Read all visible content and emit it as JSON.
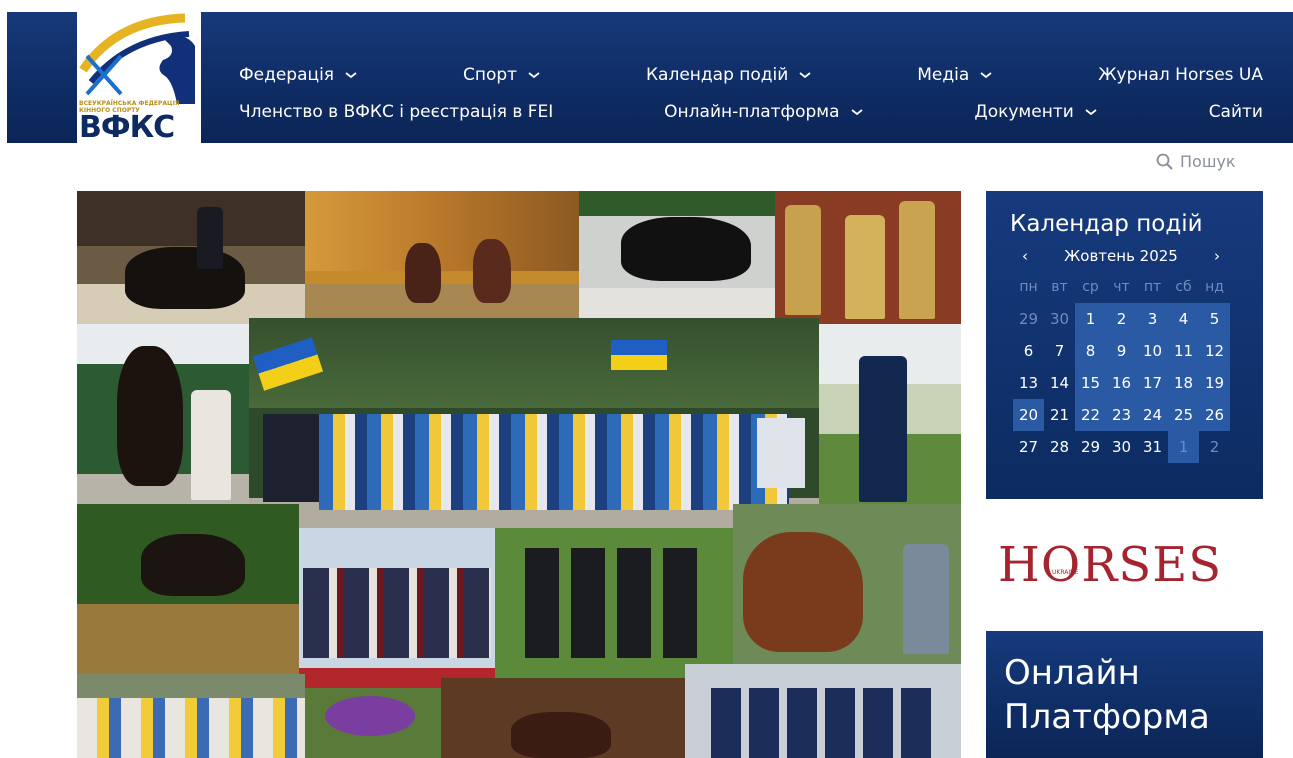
{
  "header": {
    "logo": {
      "alt_text_small": "ВСЕУКРАЇНСЬКА ФЕДЕРАЦІЯ КІННОГО СПОРТУ",
      "abbr": "ВФКС"
    },
    "nav_row_1": [
      {
        "label": "Федерація",
        "dropdown": true
      },
      {
        "label": "Спорт",
        "dropdown": true
      },
      {
        "label": "Календар подій",
        "dropdown": true
      },
      {
        "label": "Медіа",
        "dropdown": true
      },
      {
        "label": "Журнал Horses UA",
        "dropdown": false
      }
    ],
    "nav_row_2": [
      {
        "label": "Членство в ВФКС і реєстрація в FEI",
        "dropdown": false
      },
      {
        "label": "Онлайн-платформа",
        "dropdown": true
      },
      {
        "label": "Документи",
        "dropdown": true
      },
      {
        "label": "Сайти",
        "dropdown": false
      }
    ]
  },
  "search": {
    "label": "Пошук",
    "icon": "search-icon"
  },
  "calendar": {
    "title": "Календар подій",
    "month_label": "Жовтень 2025",
    "prev": "‹",
    "next": "›",
    "weekdays": [
      "пн",
      "вт",
      "ср",
      "чт",
      "пт",
      "сб",
      "нд"
    ],
    "weeks": [
      [
        {
          "d": "29",
          "other": true
        },
        {
          "d": "30",
          "other": true
        },
        {
          "d": "1",
          "hl": true
        },
        {
          "d": "2",
          "hl": true
        },
        {
          "d": "3",
          "hl": true
        },
        {
          "d": "4",
          "hl": true
        },
        {
          "d": "5",
          "hl": true
        }
      ],
      [
        {
          "d": "6"
        },
        {
          "d": "7"
        },
        {
          "d": "8",
          "hl": true
        },
        {
          "d": "9",
          "hl": true
        },
        {
          "d": "10",
          "hl": true
        },
        {
          "d": "11",
          "hl": true
        },
        {
          "d": "12",
          "hl": true
        }
      ],
      [
        {
          "d": "13"
        },
        {
          "d": "14"
        },
        {
          "d": "15",
          "hl": true
        },
        {
          "d": "16",
          "hl": true
        },
        {
          "d": "17",
          "hl": true
        },
        {
          "d": "18",
          "hl": true
        },
        {
          "d": "19",
          "hl": true
        }
      ],
      [
        {
          "d": "20",
          "hl": true
        },
        {
          "d": "21"
        },
        {
          "d": "22",
          "hl": true
        },
        {
          "d": "23",
          "hl": true
        },
        {
          "d": "24",
          "hl": true
        },
        {
          "d": "25",
          "hl": true
        },
        {
          "d": "26",
          "hl": true
        }
      ],
      [
        {
          "d": "27"
        },
        {
          "d": "28"
        },
        {
          "d": "29"
        },
        {
          "d": "30"
        },
        {
          "d": "31"
        },
        {
          "d": "1",
          "other": true,
          "hl": true
        },
        {
          "d": "2",
          "other": true
        }
      ]
    ]
  },
  "horses_banner": {
    "word": "HORSES",
    "sub": "UKRAINE"
  },
  "online_platform": {
    "line1": "Онлайн",
    "line2": "Платформа"
  },
  "colors": {
    "header_blue": "#0f2d66",
    "calendar_highlight": "#2a5aa3",
    "horses_red": "#a5242f",
    "logo_gold": "#e6b422"
  }
}
